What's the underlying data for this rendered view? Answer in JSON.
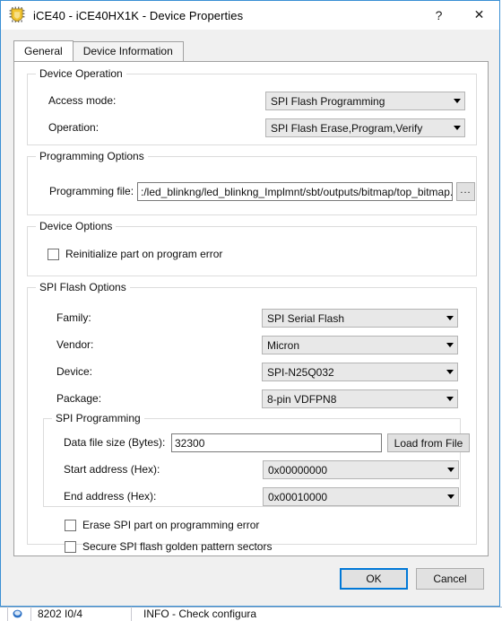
{
  "window": {
    "title": "iCE40 - iCE40HX1K - Device Properties",
    "icon": "chip-icon",
    "help_label": "?",
    "close_label": "✕"
  },
  "tabs": [
    {
      "label": "General",
      "active": true
    },
    {
      "label": "Device Information",
      "active": false
    }
  ],
  "groups": {
    "device_operation": {
      "legend": "Device Operation",
      "fields": [
        {
          "label": "Access mode:",
          "value": "SPI Flash Programming"
        },
        {
          "label": "Operation:",
          "value": "SPI Flash Erase,Program,Verify"
        }
      ]
    },
    "programming_options": {
      "legend": "Programming Options",
      "file_label": "Programming file:",
      "file_value": ":/led_blinkng/led_blinkng_Implmnt/sbt/outputs/bitmap/top_bitmap.bin",
      "browse_label": "..."
    },
    "device_options": {
      "legend": "Device Options",
      "checkbox_label": "Reinitialize part on program error",
      "checked": false
    },
    "spi_flash_options": {
      "legend": "SPI Flash Options",
      "fields": [
        {
          "label": "Family:",
          "value": "SPI Serial Flash"
        },
        {
          "label": "Vendor:",
          "value": "Micron"
        },
        {
          "label": "Device:",
          "value": "SPI-N25Q032"
        },
        {
          "label": "Package:",
          "value": "8-pin VDFPN8"
        }
      ],
      "spi_programming": {
        "legend": "SPI Programming",
        "data_file_size_label": "Data file size (Bytes):",
        "data_file_size_value": "32300",
        "load_from_file_label": "Load from File",
        "start_address_label": "Start address (Hex):",
        "start_address_value": "0x00000000",
        "end_address_label": "End address (Hex):",
        "end_address_value": "0x00010000"
      },
      "checkboxes": [
        {
          "label": "Erase SPI part on programming error",
          "checked": false
        },
        {
          "label": "Secure SPI flash golden pattern sectors",
          "checked": false
        }
      ]
    }
  },
  "footer": {
    "ok_label": "OK",
    "cancel_label": "Cancel"
  },
  "background": {
    "col1_text": "8202 I0/4",
    "col2_text": "INFO - Check configura"
  },
  "colors": {
    "accent": "#0078d7",
    "dialog_border": "#3a8fd4",
    "combo_bg": "#e8e8e8",
    "title_icon": "#f2c531"
  }
}
